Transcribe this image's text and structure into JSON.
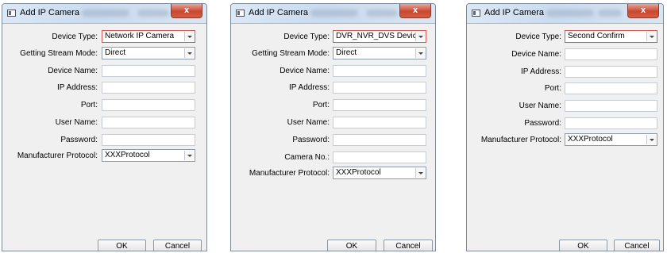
{
  "dialogs": [
    {
      "title": "Add IP Camera",
      "close_label": "x",
      "device_type_label": "Device Type:",
      "device_type_value": "Network IP Camera",
      "stream_mode_label": "Getting Stream Mode:",
      "stream_mode_value": "Direct",
      "device_name_label": "Device Name:",
      "ip_address_label": "IP Address:",
      "port_label": "Port:",
      "user_name_label": "User Name:",
      "password_label": "Password:",
      "protocol_label": "Manufacturer Protocol:",
      "protocol_value": "XXXProtocol",
      "ok_label": "OK",
      "cancel_label": "Cancel"
    },
    {
      "title": "Add IP Camera",
      "close_label": "x",
      "device_type_label": "Device Type:",
      "device_type_value": "DVR_NVR_DVS Device",
      "stream_mode_label": "Getting Stream Mode:",
      "stream_mode_value": "Direct",
      "device_name_label": "Device Name:",
      "ip_address_label": "IP Address:",
      "port_label": "Port:",
      "user_name_label": "User Name:",
      "password_label": "Password:",
      "camera_no_label": "Camera No.:",
      "protocol_label": "Manufacturer Protocol:",
      "protocol_value": "XXXProtocol",
      "ok_label": "OK",
      "cancel_label": "Cancel"
    },
    {
      "title": "Add IP Camera",
      "close_label": "x",
      "device_type_label": "Device Type:",
      "device_type_value": "Second Confirm",
      "device_name_label": "Device Name:",
      "ip_address_label": "IP Address:",
      "port_label": "Port:",
      "user_name_label": "User Name:",
      "password_label": "Password:",
      "protocol_label": "Manufacturer Protocol:",
      "protocol_value": "XXXProtocol",
      "ok_label": "OK",
      "cancel_label": "Cancel"
    }
  ],
  "icons": {
    "window_icon": "window-icon",
    "dropdown_icon": "chevron-down-icon"
  },
  "colors": {
    "focus_border": "#d9534f",
    "close_button": "#c9482f"
  }
}
